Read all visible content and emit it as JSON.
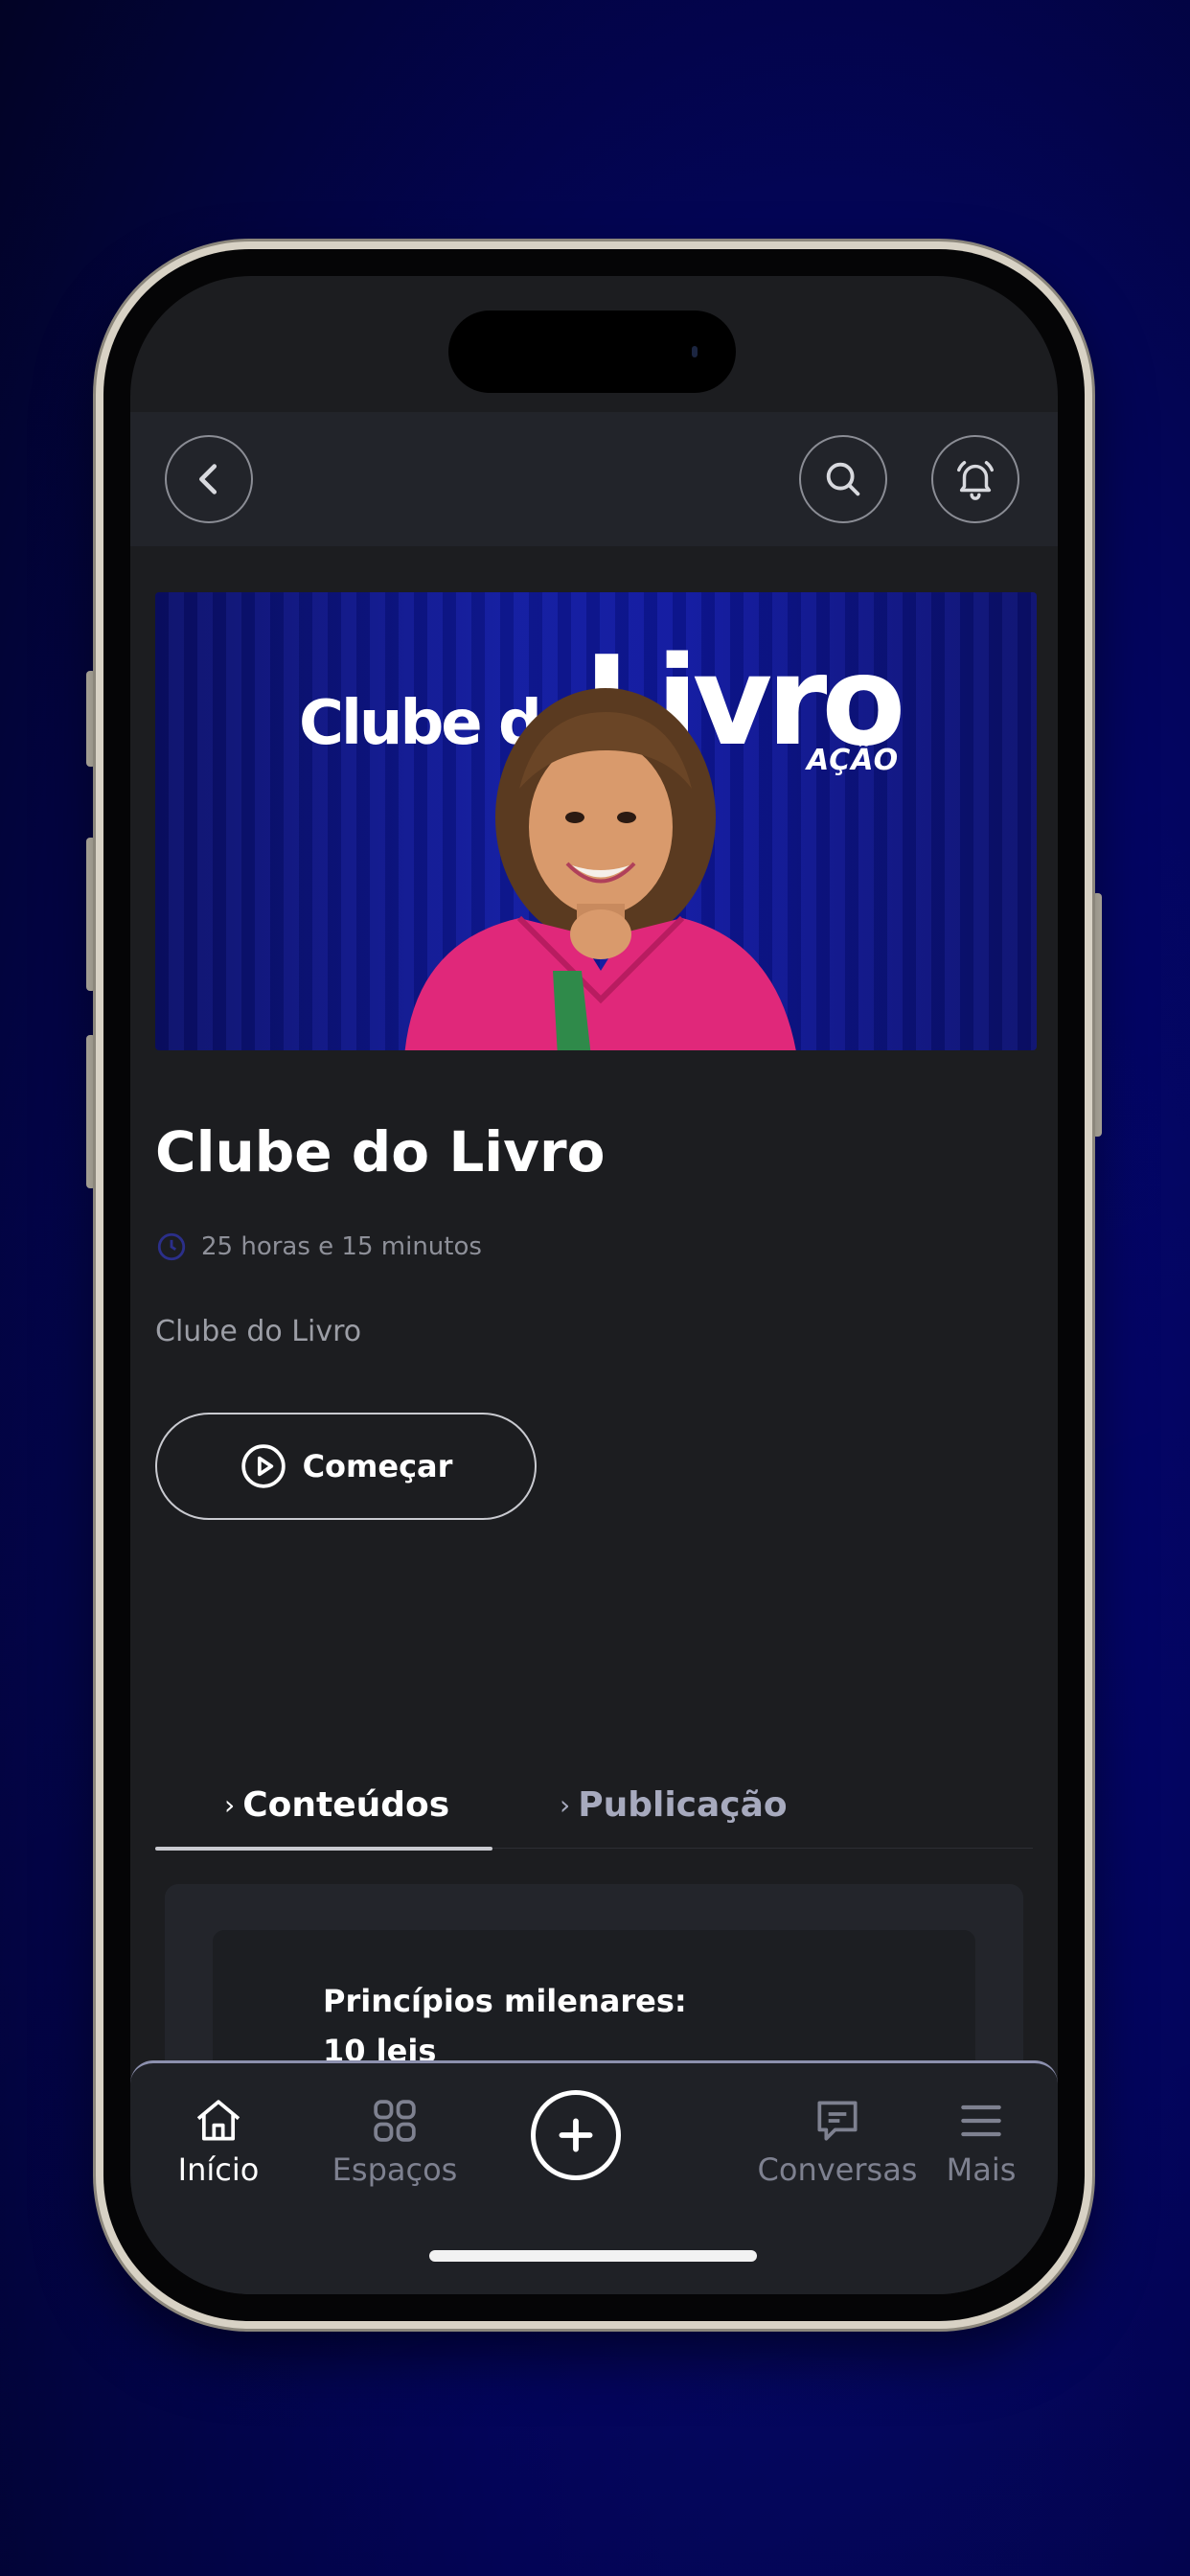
{
  "colors": {
    "background": "#03055a",
    "screen": "#1c1d20",
    "banner_blue": "#101aa0",
    "accent_pink": "#e0287a"
  },
  "header": {
    "back_icon": "chevron-left-icon",
    "search_icon": "search-icon",
    "notifications_icon": "bell-icon"
  },
  "banner": {
    "title_small": "Clube do",
    "title_big": "Livro",
    "brand": "AÇÃO"
  },
  "course": {
    "title": "Clube do Livro",
    "duration": "25 horas e 15 minutos",
    "description": "Clube do Livro",
    "start_label": "Começar"
  },
  "tabs": [
    {
      "label": "Conteúdos",
      "active": true
    },
    {
      "label": "Publicação",
      "active": false
    }
  ],
  "content_card": {
    "title": "Princípios milenares: 10 leis"
  },
  "bottom_nav": [
    {
      "label": "Início",
      "icon": "home-icon",
      "active": true
    },
    {
      "label": "Espaços",
      "icon": "grid-icon",
      "active": false
    },
    {
      "label": "",
      "icon": "plus-circle-icon",
      "active": false
    },
    {
      "label": "Conversas",
      "icon": "chat-icon",
      "active": false
    },
    {
      "label": "Mais",
      "icon": "menu-icon",
      "active": false
    }
  ]
}
